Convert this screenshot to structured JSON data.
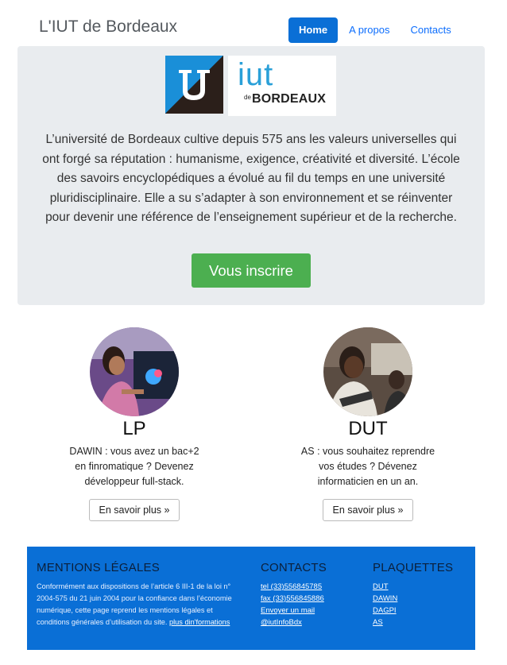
{
  "header": {
    "brand": "L'IUT de Bordeaux",
    "nav": [
      {
        "label": "Home",
        "active": true
      },
      {
        "label": "A propos",
        "active": false
      },
      {
        "label": "Contacts",
        "active": false
      }
    ]
  },
  "jumbotron": {
    "logo_text": "iut",
    "logo_small": "de",
    "logo_city": "BORDEAUX",
    "paragraph": "L’université de Bordeaux cultive depuis 575 ans les valeurs universelles qui ont forgé sa réputation : humanisme, exigence, créativité et diversité. L’école des savoirs encyclopédiques a évolué au fil du temps en une université pluridisciplinaire. Elle a su s’adapter à son environnement et se réinventer pour devenir une référence de l’enseignement supérieur et de la recherche.",
    "cta_label": "Vous inscrire"
  },
  "columns": [
    {
      "title": "LP",
      "text": "DAWIN : vous avez un bac+2 en finromatique ? Devenez développeur full-stack.",
      "button": "En savoir plus »"
    },
    {
      "title": "DUT",
      "text": "AS : vous souhaitez reprendre vos études ? Dévenez informaticien en un an.",
      "button": "En savoir plus »"
    }
  ],
  "footer": {
    "legal_title": "MENTIONS LÉGALES",
    "legal_text": "Conformément aux dispositions de l’article 6 III-1 de la loi n° 2004-575 du 21 juin 2004 pour la confiance dans l’économie numérique, cette page reprend les mentions légales et conditions générales d’utilisation du site.",
    "legal_link": "plus din'formations",
    "contacts_title": "CONTACTS",
    "contacts": [
      "tel (33)556845785",
      "fax (33)556845886",
      "Envoyer un mail",
      "@iutInfoBdx"
    ],
    "plaquettes_title": "PLAQUETTES",
    "plaquettes": [
      "DUT",
      "DAWIN",
      "DAGPI",
      "AS"
    ]
  },
  "colors": {
    "primary": "#0a6fd6",
    "success": "#4caf50",
    "jumbotron_bg": "#e9ecef"
  }
}
